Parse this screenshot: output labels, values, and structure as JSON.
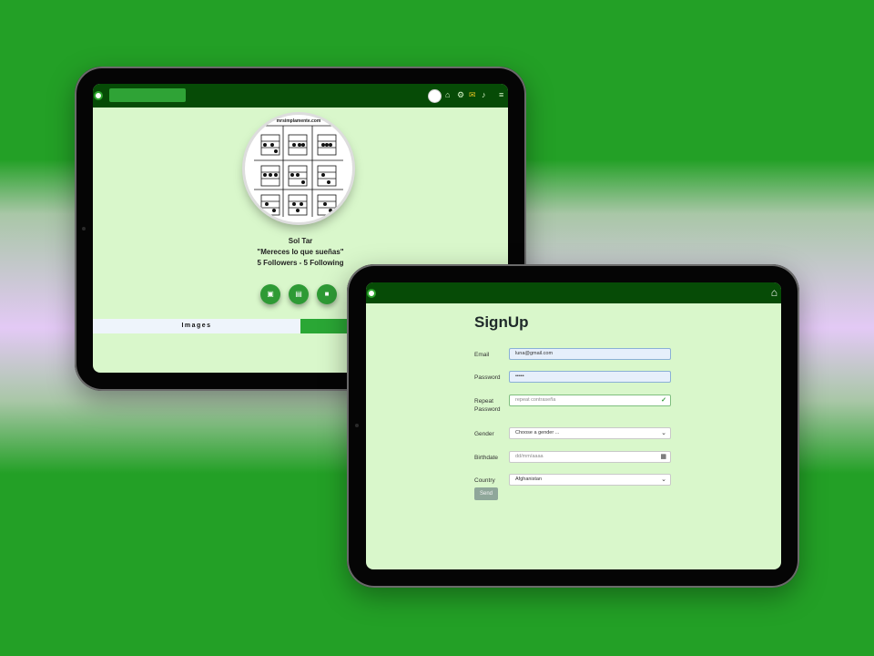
{
  "colors": {
    "background": "#23a026",
    "navbar": "#064b06",
    "screen": "#d9f7cb",
    "accent": "#2e9a35"
  },
  "profile": {
    "image_site_text": "mrsimplamente.com",
    "name": "Sol Tar",
    "quote": "\"Mereces lo que sueñas\"",
    "stats": "5 Followers - 5 Following",
    "nav_icons": [
      "avatar",
      "home-icon",
      "gear-icon",
      "mail-icon",
      "bell-icon",
      "menu-icon"
    ],
    "action_buttons": [
      "image-icon",
      "list-icon",
      "video-icon"
    ],
    "tabs": [
      {
        "label": "Images"
      }
    ]
  },
  "signup": {
    "title": "SignUp",
    "fields": {
      "email": {
        "label": "Email",
        "value": "luna@gmail.com"
      },
      "password": {
        "label": "Password",
        "value": "•••••"
      },
      "repeat_password": {
        "label": "Repeat Password",
        "placeholder": "repeat contraseña"
      },
      "gender": {
        "label": "Gender",
        "selected": "Choose a gender ..."
      },
      "birthdate": {
        "label": "Birthdate",
        "placeholder": "dd/mm/aaaa"
      },
      "country": {
        "label": "Country",
        "selected": "Afghanistan"
      }
    },
    "send_label": "Send"
  }
}
